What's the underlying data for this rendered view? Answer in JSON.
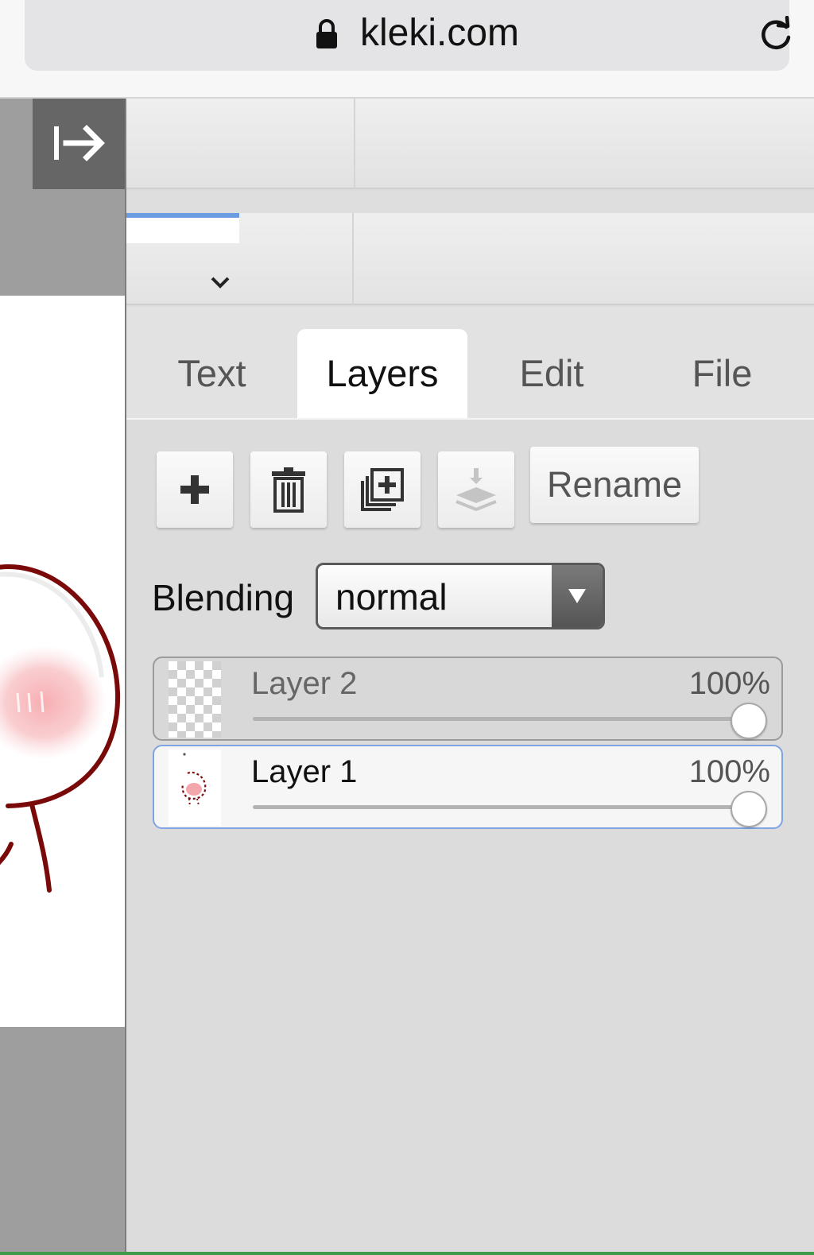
{
  "browser": {
    "url": "kleki.com",
    "lock_icon": "lock-icon",
    "reload_icon": "reload-icon"
  },
  "sidebar": {
    "collapse_icon": "collapse-panel-icon"
  },
  "tabs": [
    {
      "label": "Text",
      "active": false
    },
    {
      "label": "Layers",
      "active": true
    },
    {
      "label": "Edit",
      "active": false
    },
    {
      "label": "File",
      "active": false
    }
  ],
  "toolbar": {
    "add_icon": "plus-icon",
    "delete_icon": "trash-icon",
    "duplicate_icon": "duplicate-icon",
    "merge_icon": "merge-down-icon",
    "rename_label": "Rename"
  },
  "blending": {
    "label": "Blending",
    "value": "normal"
  },
  "layers": [
    {
      "name": "Layer 2",
      "opacity": "100%",
      "opacity_value": 1.0,
      "selected": false
    },
    {
      "name": "Layer 1",
      "opacity": "100%",
      "opacity_value": 1.0,
      "selected": true
    }
  ],
  "colors": {
    "accent": "#6b9be0",
    "drawing_stroke": "#7a0a0a",
    "blush": "#f7b3b8"
  }
}
